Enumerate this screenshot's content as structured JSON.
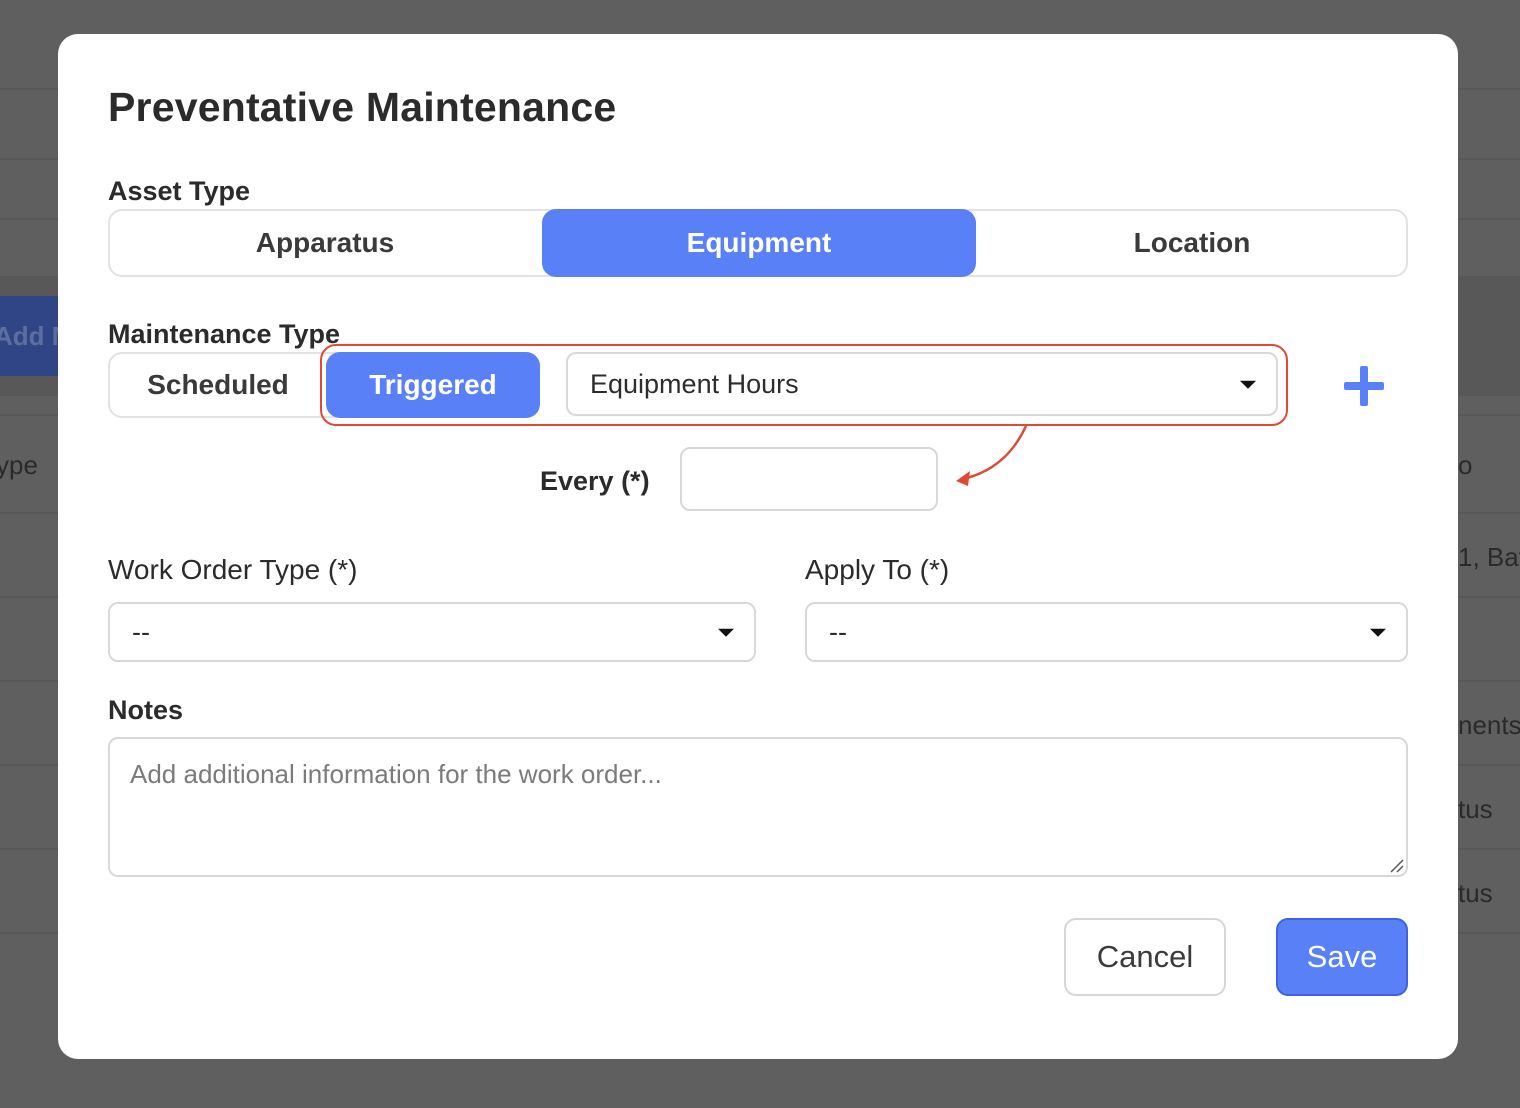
{
  "background": {
    "add_button_label": "Add M",
    "column_type_fragment": "ype",
    "right_column_fragments": [
      "o",
      "1, Bat",
      "nents",
      "tus",
      "tus"
    ]
  },
  "modal": {
    "title": "Preventative Maintenance",
    "asset_type": {
      "label": "Asset Type",
      "options": [
        "Apparatus",
        "Equipment",
        "Location"
      ],
      "selected": "Equipment"
    },
    "maintenance_type": {
      "label": "Maintenance Type",
      "options": [
        "Scheduled",
        "Triggered"
      ],
      "selected": "Triggered",
      "trigger_select_value": "Equipment Hours"
    },
    "every": {
      "label": "Every (*)",
      "value": ""
    },
    "work_order_type": {
      "label": "Work Order Type (*)",
      "value": "--"
    },
    "apply_to": {
      "label": "Apply To (*)",
      "value": "--"
    },
    "notes": {
      "label": "Notes",
      "placeholder": "Add additional information for the work order...",
      "value": ""
    },
    "buttons": {
      "cancel": "Cancel",
      "save": "Save"
    }
  },
  "icons": {
    "add": "plus-icon",
    "dropdown": "caret-down-icon",
    "resize": "resize-grip-icon",
    "annotation_arrow": "curved-arrow"
  },
  "colors": {
    "accent": "#5a80f7",
    "annotation": "#e04a33",
    "overlay": "#5f5f5f"
  }
}
